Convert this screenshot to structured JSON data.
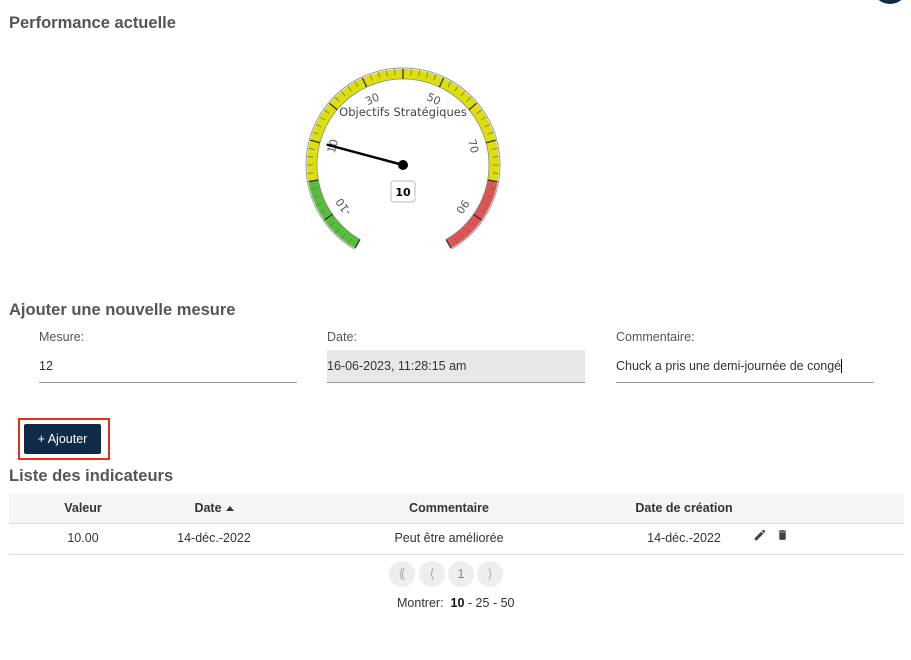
{
  "sections": {
    "performance_title": "Performance actuelle",
    "add_title": "Ajouter une nouvelle mesure",
    "list_title": "Liste des indicateurs"
  },
  "gauge": {
    "title": "Objectifs Stratégiques",
    "value": 10,
    "value_label": "10",
    "min": -20,
    "max": 100,
    "tick_labels": [
      "-10",
      "10",
      "30",
      "50",
      "70",
      "90"
    ],
    "bands": [
      {
        "from": -20,
        "to": 0,
        "color": "#55bf3b"
      },
      {
        "from": 0,
        "to": 80,
        "color": "#dddf0d"
      },
      {
        "from": 80,
        "to": 100,
        "color": "#df5353"
      }
    ]
  },
  "form": {
    "mesure_label": "Mesure:",
    "mesure_value": "12",
    "date_label": "Date:",
    "date_value": "16-06-2023, 11:28:15 am",
    "comment_label": "Commentaire:",
    "comment_value": "Chuck a pris une demi-journée de congé",
    "add_button": "+ Ajouter"
  },
  "table": {
    "headers": {
      "valeur": "Valeur",
      "date": "Date",
      "commentaire": "Commentaire",
      "date_creation": "Date de création"
    },
    "rows": [
      {
        "valeur": "10.00",
        "date": "14-déc.-2022",
        "commentaire": "Peut être améliorée",
        "date_creation": "14-déc.-2022",
        "icons": [
          "pencil-icon",
          "trash-icon"
        ]
      }
    ]
  },
  "pagination": {
    "first": "⟪",
    "prev": "⟨",
    "page": "1",
    "next": "⟩",
    "show_label": "Montrer:",
    "sizes": [
      "10",
      "25",
      "50"
    ],
    "separator": "-"
  },
  "colors": {
    "primary_button": "#0f2b4a",
    "highlight": "#e0301e"
  }
}
